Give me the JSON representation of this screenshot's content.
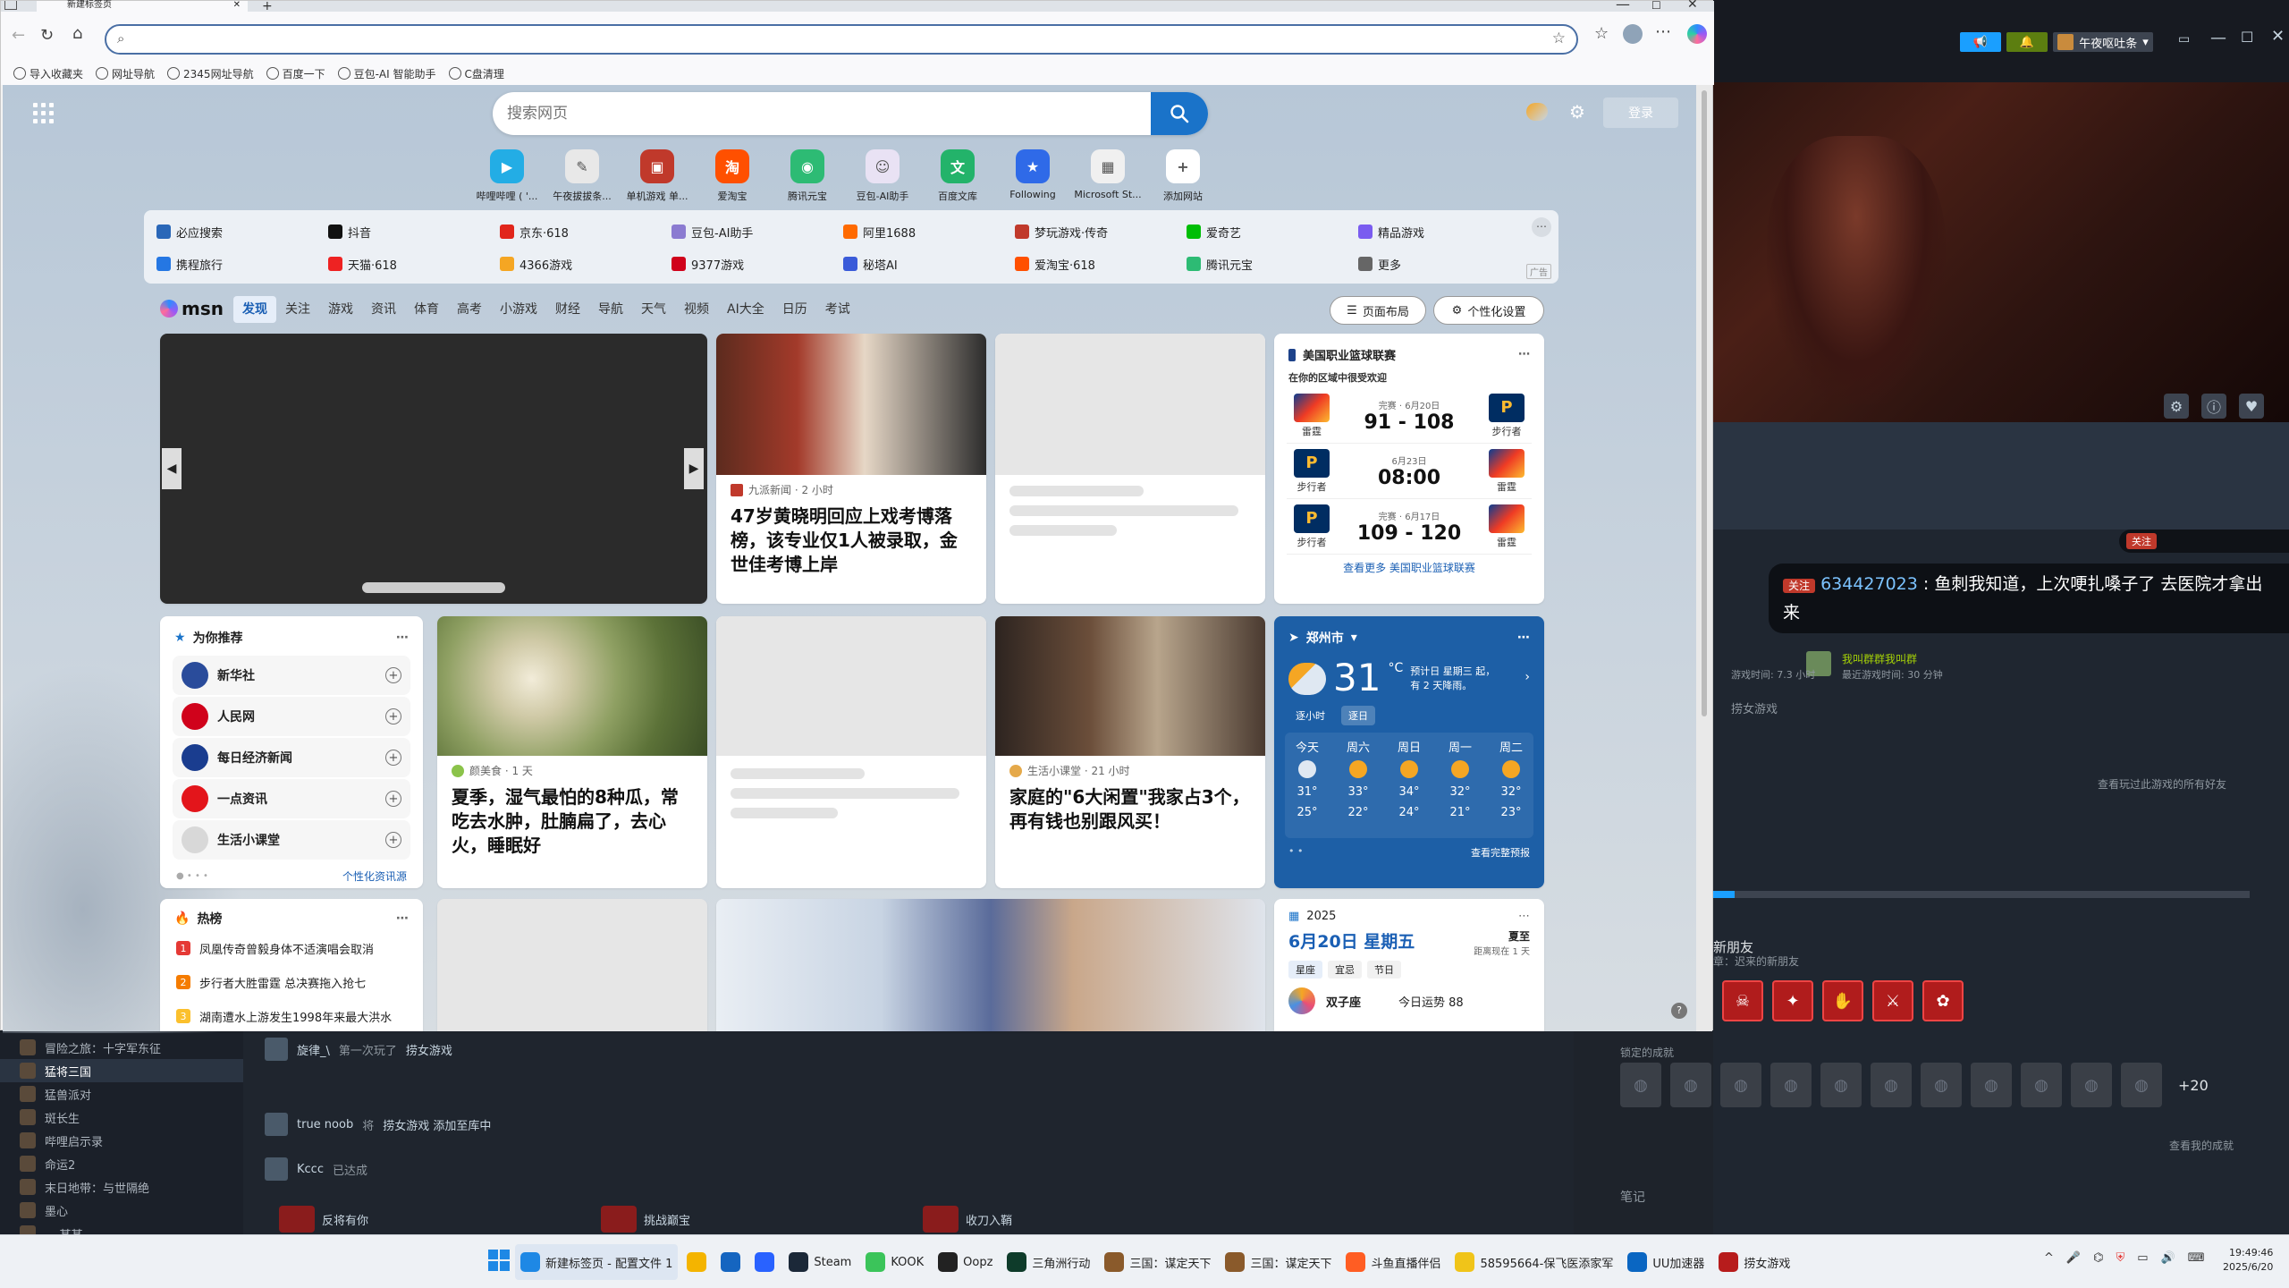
{
  "browser": {
    "tab_title": "新建标签页",
    "address_value": "",
    "bookmarks": [
      "导入收藏夹",
      "网址导航",
      "2345网址导航",
      "百度一下",
      "豆包-AI 智能助手",
      "C盘清理"
    ]
  },
  "newtab": {
    "search_placeholder": "搜索网页",
    "login_label": "登录",
    "quick_links": [
      {
        "label": "哔哩哔哩 ( '...",
        "color": "#23ade5",
        "glyph": "▶"
      },
      {
        "label": "午夜拔拔条...",
        "color": "#e8e8e8",
        "glyph": "✎"
      },
      {
        "label": "单机游戏 单...",
        "color": "#c0392b",
        "glyph": "▣"
      },
      {
        "label": "爱淘宝",
        "color": "#ff5000",
        "glyph": "淘"
      },
      {
        "label": "腾讯元宝",
        "color": "#2dbb74",
        "glyph": "◉"
      },
      {
        "label": "豆包-AI助手",
        "color": "#e9e2f4",
        "glyph": "☺"
      },
      {
        "label": "百度文库",
        "color": "#23b36a",
        "glyph": "文"
      },
      {
        "label": "Following",
        "color": "#2f6ae8",
        "glyph": "★"
      },
      {
        "label": "Microsoft St...",
        "color": "#f0f0f0",
        "glyph": "▦"
      },
      {
        "label": "添加网站",
        "color": "#ffffff",
        "glyph": "+"
      }
    ],
    "hot_links": [
      {
        "label": "必应搜索",
        "color": "#2a67b8"
      },
      {
        "label": "抖音",
        "color": "#111"
      },
      {
        "label": "京东·618",
        "color": "#e1251b"
      },
      {
        "label": "豆包-AI助手",
        "color": "#8b7bd1"
      },
      {
        "label": "阿里1688",
        "color": "#ff6a00"
      },
      {
        "label": "梦玩游戏·传奇",
        "color": "#c0392b"
      },
      {
        "label": "爱奇艺",
        "color": "#00be06"
      },
      {
        "label": "精品游戏",
        "color": "#7a5cf0"
      },
      {
        "label": "携程旅行",
        "color": "#2577e3"
      },
      {
        "label": "天猫·618",
        "color": "#e22"
      },
      {
        "label": "4366游戏",
        "color": "#f5a623"
      },
      {
        "label": "9377游戏",
        "color": "#d0021b"
      },
      {
        "label": "秘塔AI",
        "color": "#3a5bd9"
      },
      {
        "label": "爱淘宝·618",
        "color": "#ff5000"
      },
      {
        "label": "腾讯元宝",
        "color": "#2dbb74"
      },
      {
        "label": "更多",
        "color": "#666"
      }
    ],
    "ad_label": "广告"
  },
  "msn": {
    "logo": "msn",
    "tabs": [
      "发现",
      "关注",
      "游戏",
      "资讯",
      "体育",
      "高考",
      "小游戏",
      "财经",
      "导航",
      "天气",
      "视频",
      "AI大全",
      "日历",
      "考试"
    ],
    "layout_btn": "页面布局",
    "personalize_btn": "个性化设置",
    "news1": {
      "source": "九派新闻 · 2 小时",
      "title": "47岁黄晓明回应上戏考博落榜，该专业仅1人被录取，金世佳考博上岸"
    },
    "news2": {
      "source": "颜美食 · 1 天",
      "title": "夏季，湿气最怕的8种瓜，常吃去水肿，肚腩扁了，去心火，睡眠好"
    },
    "news3": {
      "source": "生活小课堂 · 21 小时",
      "title": "家庭的\"6大闲置\"我家占3个，再有钱也别跟风买！"
    },
    "nba": {
      "title": "美国职业篮球联赛",
      "subtitle": "在你的区域中很受欢迎",
      "games": [
        {
          "left": "雷霆",
          "right": "步行者",
          "meta": "完赛 · 6月20日",
          "score": "91 - 108"
        },
        {
          "left": "步行者",
          "right": "雷霆",
          "meta": "6月23日",
          "score": "08:00"
        },
        {
          "left": "步行者",
          "right": "雷霆",
          "meta": "完赛 · 6月17日",
          "score": "109 - 120"
        }
      ],
      "more": "查看更多 美国职业篮球联赛"
    },
    "recommend": {
      "title": "为你推荐",
      "items": [
        {
          "label": "新华社",
          "color": "#2a4c9b"
        },
        {
          "label": "人民网",
          "color": "#d0021b"
        },
        {
          "label": "每日经济新闻",
          "color": "#1a3d8f"
        },
        {
          "label": "一点资讯",
          "color": "#e3151b"
        },
        {
          "label": "生活小课堂",
          "color": "#d8d8d8"
        }
      ],
      "link": "个性化资讯源"
    },
    "weather": {
      "city": "郑州市",
      "temp": "31",
      "unit": "°C",
      "desc": "预计日 星期三 起，有 2 天降雨。",
      "tabs": [
        "逐小时",
        "逐日"
      ],
      "days": [
        {
          "d": "今天",
          "hi": "31°",
          "lo": "25°"
        },
        {
          "d": "周六",
          "hi": "33°",
          "lo": "22°"
        },
        {
          "d": "周日",
          "hi": "34°",
          "lo": "24°"
        },
        {
          "d": "周一",
          "hi": "32°",
          "lo": "21°"
        },
        {
          "d": "周二",
          "hi": "32°",
          "lo": "23°"
        }
      ],
      "more": "查看完整预报"
    },
    "hot": {
      "title": "热榜",
      "items": [
        {
          "rank": "1",
          "text": "凤凰传奇曾毅身体不适演唱会取消",
          "color": "#e53935"
        },
        {
          "rank": "2",
          "text": "步行者大胜雷霆 总决赛拖入抢七",
          "color": "#f57c00"
        },
        {
          "rank": "3",
          "text": "湖南遭水上游发生1998年来最大洪水",
          "color": "#fbc02d"
        }
      ]
    },
    "calendar": {
      "year": "2025",
      "date": "6月20日 星期五",
      "tag": "夏至",
      "tag_sub": "距离现在 1 天",
      "tabs": [
        "星座",
        "宜忌",
        "节日"
      ],
      "sign": "双子座",
      "fortune": "今日运势 88"
    }
  },
  "steam": {
    "user": "午夜呕吐条",
    "chat_user": "634427023",
    "chat_msg": "鱼刺我知道，上次哽扎嗓子了 去医院才拿出来",
    "follow_label": "关注",
    "friend_name": "我叫群群我叫群",
    "friend_sub": "最近游戏时间: 30 分钟",
    "played_hours": "游戏时间: 7.3 小时",
    "game_name": "捞女游戏",
    "friends_link": "查看玩过此游戏的所有好友",
    "new_friends": "新朋友",
    "new_friends_sub": "章：迟来的新朋友",
    "locked_label": "锁定的成就",
    "plus_count": "+20",
    "view_ach": "查看我的成就",
    "notes": "笔记",
    "games": [
      "冒险之旅：十字军东征",
      "猛将三国",
      "猛兽派对",
      "斑长生",
      "哔哩启示录",
      "命运2",
      "末日地带：与世隔绝",
      "墨心",
      "... 某某 ..."
    ],
    "feed": [
      {
        "user": "旋律_\\",
        "text": "第一次玩了",
        "game": "捞女游戏"
      },
      {
        "user": "true noob",
        "text": "将",
        "game": "捞女游戏 添加至库中"
      },
      {
        "user": "Kccc",
        "text": "已达成",
        "game": ""
      }
    ],
    "ach_bottom": [
      "反将有你",
      "挑战巅宝",
      "收刀入鞘"
    ]
  },
  "taskbar": {
    "items": [
      {
        "label": "新建标签页 - 配置文件 1",
        "color": "#1e88e5"
      },
      {
        "label": "",
        "color": "#f4b400"
      },
      {
        "label": "",
        "color": "#1565c0"
      },
      {
        "label": "",
        "color": "#2962ff"
      },
      {
        "label": "Steam",
        "color": "#1b2838"
      },
      {
        "label": "KOOK",
        "color": "#3bc45a"
      },
      {
        "label": "Oopz",
        "color": "#222"
      },
      {
        "label": "三角洲行动",
        "color": "#0e3b2a"
      },
      {
        "label": "三国：谋定天下",
        "color": "#8a5a2b"
      },
      {
        "label": "三国：谋定天下",
        "color": "#8a5a2b"
      },
      {
        "label": "斗鱼直播伴侣",
        "color": "#ff5d23"
      },
      {
        "label": "58595664-保飞医添家军",
        "color": "#f0c419"
      },
      {
        "label": "UU加速器",
        "color": "#0a66c2"
      },
      {
        "label": "捞女游戏",
        "color": "#b71c1c"
      }
    ],
    "time": "19:49:46",
    "date": "2025/6/20"
  }
}
